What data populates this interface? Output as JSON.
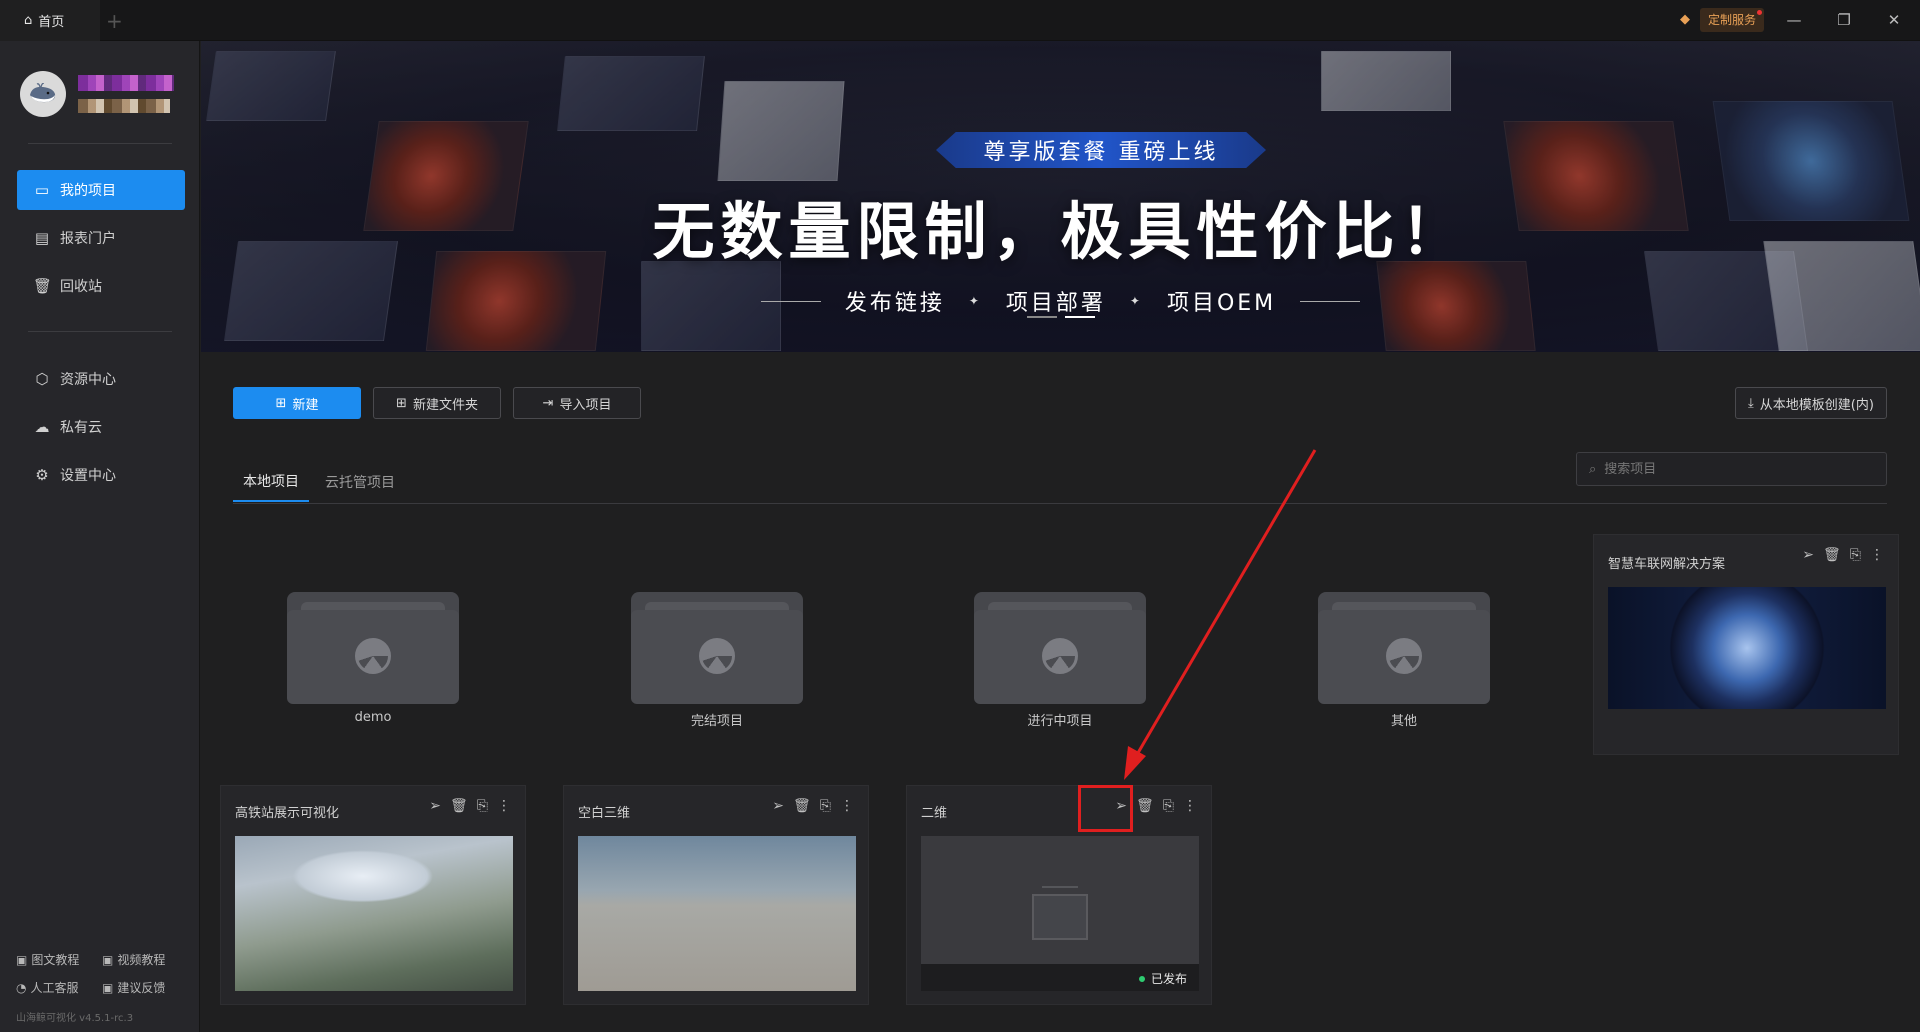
{
  "titlebar": {
    "home_tab": "首页",
    "add_tab": "+",
    "service_label": "定制服务",
    "minimize": "—",
    "restore": "❐",
    "close": "✕"
  },
  "sidebar": {
    "nav": [
      {
        "label": "我的项目",
        "icon": "monitor-icon"
      },
      {
        "label": "报表门户",
        "icon": "chart-icon"
      },
      {
        "label": "回收站",
        "icon": "trash-icon"
      },
      {
        "label": "资源中心",
        "icon": "cube-icon"
      },
      {
        "label": "私有云",
        "icon": "cloud-icon"
      },
      {
        "label": "设置中心",
        "icon": "gear-icon"
      }
    ],
    "footer": {
      "tutorial_text": "图文教程",
      "tutorial_video": "视频教程",
      "support": "人工客服",
      "feedback": "建议反馈",
      "version": "山海鲸可视化 v4.5.1-rc.3"
    }
  },
  "banner": {
    "ribbon": "尊享版套餐 重磅上线",
    "headline": "无数量限制，极具性价比！",
    "features": [
      "发布链接",
      "项目部署",
      "项目OEM"
    ]
  },
  "toolbar": {
    "new": "新建",
    "new_folder": "新建文件夹",
    "import": "导入项目",
    "from_template": "从本地模板创建(内)"
  },
  "tabs": [
    "本地项目",
    "云托管项目"
  ],
  "search": {
    "placeholder": "搜索项目"
  },
  "folders": [
    "demo",
    "完结项目",
    "进行中项目",
    "其他"
  ],
  "projects": [
    {
      "title": "智慧车联网解决方案"
    },
    {
      "title": "高铁站展示可视化"
    },
    {
      "title": "空白三维"
    },
    {
      "title": "二维",
      "status": "已发布"
    }
  ],
  "colors": {
    "accent": "#1c8cf0",
    "highlight": "#e01f1f",
    "published": "#2ecc71"
  }
}
